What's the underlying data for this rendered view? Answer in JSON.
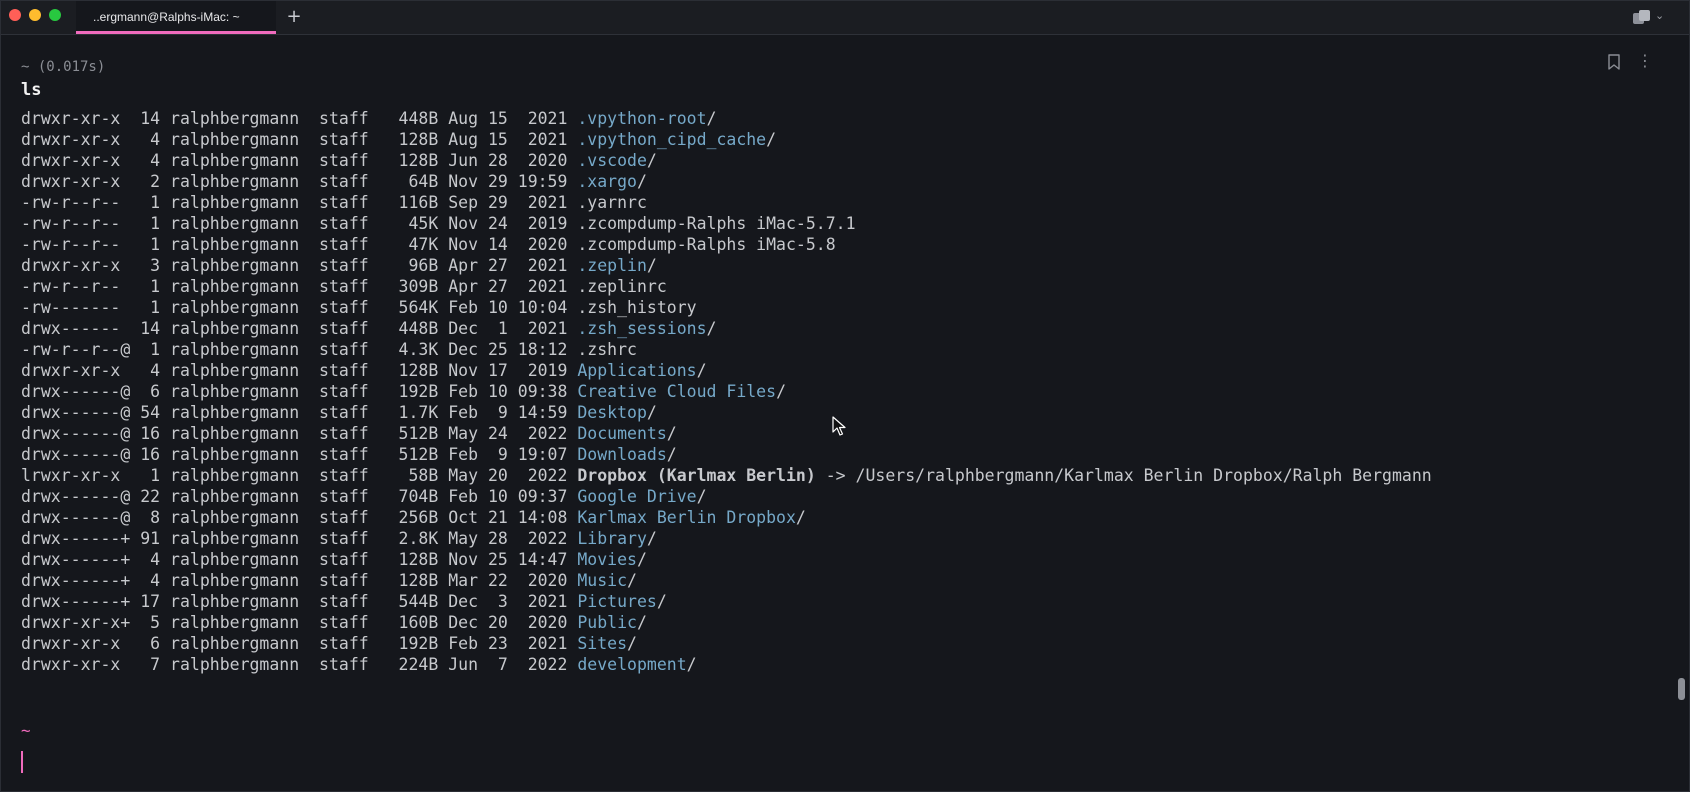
{
  "window": {
    "tab_title": "..ergmann@Ralphs-iMac: ~",
    "new_tab_icon": "plus-icon",
    "panes_icon": "panes-icon"
  },
  "block": {
    "meta": "~ (0.017s)",
    "command": "ls",
    "bookmark_icon": "bookmark-icon",
    "more_icon": "more-vertical-icon"
  },
  "listing": [
    {
      "perms": "drwxr-xr-x ",
      "links": "14",
      "owner": "ralphbergmann",
      "group": "staff",
      "size": "448B",
      "date": "Aug 15  2021",
      "name": ".vpython-root",
      "suffix": "/",
      "kind": "dir"
    },
    {
      "perms": "drwxr-xr-x ",
      "links": " 4",
      "owner": "ralphbergmann",
      "group": "staff",
      "size": "128B",
      "date": "Aug 15  2021",
      "name": ".vpython_cipd_cache",
      "suffix": "/",
      "kind": "dir"
    },
    {
      "perms": "drwxr-xr-x ",
      "links": " 4",
      "owner": "ralphbergmann",
      "group": "staff",
      "size": "128B",
      "date": "Jun 28  2020",
      "name": ".vscode",
      "suffix": "/",
      "kind": "dir"
    },
    {
      "perms": "drwxr-xr-x ",
      "links": " 2",
      "owner": "ralphbergmann",
      "group": "staff",
      "size": " 64B",
      "date": "Nov 29 19:59",
      "name": ".xargo",
      "suffix": "/",
      "kind": "dir"
    },
    {
      "perms": "-rw-r--r-- ",
      "links": " 1",
      "owner": "ralphbergmann",
      "group": "staff",
      "size": "116B",
      "date": "Sep 29  2021",
      "name": ".yarnrc",
      "suffix": "",
      "kind": "file"
    },
    {
      "perms": "-rw-r--r-- ",
      "links": " 1",
      "owner": "ralphbergmann",
      "group": "staff",
      "size": " 45K",
      "date": "Nov 24  2019",
      "name": ".zcompdump-Ralphs iMac-5.7.1",
      "suffix": "",
      "kind": "file"
    },
    {
      "perms": "-rw-r--r-- ",
      "links": " 1",
      "owner": "ralphbergmann",
      "group": "staff",
      "size": " 47K",
      "date": "Nov 14  2020",
      "name": ".zcompdump-Ralphs iMac-5.8",
      "suffix": "",
      "kind": "file"
    },
    {
      "perms": "drwxr-xr-x ",
      "links": " 3",
      "owner": "ralphbergmann",
      "group": "staff",
      "size": " 96B",
      "date": "Apr 27  2021",
      "name": ".zeplin",
      "suffix": "/",
      "kind": "dir"
    },
    {
      "perms": "-rw-r--r-- ",
      "links": " 1",
      "owner": "ralphbergmann",
      "group": "staff",
      "size": "309B",
      "date": "Apr 27  2021",
      "name": ".zeplinrc",
      "suffix": "",
      "kind": "file"
    },
    {
      "perms": "-rw------- ",
      "links": " 1",
      "owner": "ralphbergmann",
      "group": "staff",
      "size": "564K",
      "date": "Feb 10 10:04",
      "name": ".zsh_history",
      "suffix": "",
      "kind": "file"
    },
    {
      "perms": "drwx------ ",
      "links": "14",
      "owner": "ralphbergmann",
      "group": "staff",
      "size": "448B",
      "date": "Dec  1  2021",
      "name": ".zsh_sessions",
      "suffix": "/",
      "kind": "dir"
    },
    {
      "perms": "-rw-r--r--@",
      "links": " 1",
      "owner": "ralphbergmann",
      "group": "staff",
      "size": "4.3K",
      "date": "Dec 25 18:12",
      "name": ".zshrc",
      "suffix": "",
      "kind": "file"
    },
    {
      "perms": "drwxr-xr-x ",
      "links": " 4",
      "owner": "ralphbergmann",
      "group": "staff",
      "size": "128B",
      "date": "Nov 17  2019",
      "name": "Applications",
      "suffix": "/",
      "kind": "dir"
    },
    {
      "perms": "drwx------@",
      "links": " 6",
      "owner": "ralphbergmann",
      "group": "staff",
      "size": "192B",
      "date": "Feb 10 09:38",
      "name": "Creative Cloud Files",
      "suffix": "/",
      "kind": "dir"
    },
    {
      "perms": "drwx------@",
      "links": "54",
      "owner": "ralphbergmann",
      "group": "staff",
      "size": "1.7K",
      "date": "Feb  9 14:59",
      "name": "Desktop",
      "suffix": "/",
      "kind": "dir"
    },
    {
      "perms": "drwx------@",
      "links": "16",
      "owner": "ralphbergmann",
      "group": "staff",
      "size": "512B",
      "date": "May 24  2022",
      "name": "Documents",
      "suffix": "/",
      "kind": "dir"
    },
    {
      "perms": "drwx------@",
      "links": "16",
      "owner": "ralphbergmann",
      "group": "staff",
      "size": "512B",
      "date": "Feb  9 19:07",
      "name": "Downloads",
      "suffix": "/",
      "kind": "dir"
    },
    {
      "perms": "lrwxr-xr-x ",
      "links": " 1",
      "owner": "ralphbergmann",
      "group": "staff",
      "size": " 58B",
      "date": "May 20  2022",
      "name": "Dropbox (Karlmax Berlin)",
      "suffix": "",
      "kind": "link",
      "arrow": " -> ",
      "target": "/Users/ralphbergmann/Karlmax Berlin Dropbox/Ralph Bergmann"
    },
    {
      "perms": "drwx------@",
      "links": "22",
      "owner": "ralphbergmann",
      "group": "staff",
      "size": "704B",
      "date": "Feb 10 09:37",
      "name": "Google Drive",
      "suffix": "/",
      "kind": "dir"
    },
    {
      "perms": "drwx------@",
      "links": " 8",
      "owner": "ralphbergmann",
      "group": "staff",
      "size": "256B",
      "date": "Oct 21 14:08",
      "name": "Karlmax Berlin Dropbox",
      "suffix": "/",
      "kind": "dir"
    },
    {
      "perms": "drwx------+",
      "links": "91",
      "owner": "ralphbergmann",
      "group": "staff",
      "size": "2.8K",
      "date": "May 28  2022",
      "name": "Library",
      "suffix": "/",
      "kind": "dir"
    },
    {
      "perms": "drwx------+",
      "links": " 4",
      "owner": "ralphbergmann",
      "group": "staff",
      "size": "128B",
      "date": "Nov 25 14:47",
      "name": "Movies",
      "suffix": "/",
      "kind": "dir"
    },
    {
      "perms": "drwx------+",
      "links": " 4",
      "owner": "ralphbergmann",
      "group": "staff",
      "size": "128B",
      "date": "Mar 22  2020",
      "name": "Music",
      "suffix": "/",
      "kind": "dir"
    },
    {
      "perms": "drwx------+",
      "links": "17",
      "owner": "ralphbergmann",
      "group": "staff",
      "size": "544B",
      "date": "Dec  3  2021",
      "name": "Pictures",
      "suffix": "/",
      "kind": "dir"
    },
    {
      "perms": "drwxr-xr-x+",
      "links": " 5",
      "owner": "ralphbergmann",
      "group": "staff",
      "size": "160B",
      "date": "Dec 20  2020",
      "name": "Public",
      "suffix": "/",
      "kind": "dir"
    },
    {
      "perms": "drwxr-xr-x ",
      "links": " 6",
      "owner": "ralphbergmann",
      "group": "staff",
      "size": "192B",
      "date": "Feb 23  2021",
      "name": "Sites",
      "suffix": "/",
      "kind": "dir"
    },
    {
      "perms": "drwxr-xr-x ",
      "links": " 7",
      "owner": "ralphbergmann",
      "group": "staff",
      "size": "224B",
      "date": "Jun  7  2022",
      "name": "development",
      "suffix": "/",
      "kind": "dir"
    }
  ],
  "prompt": {
    "dir": "~"
  },
  "colors": {
    "accent": "#f06bbd",
    "directory": "#76a9c9",
    "text": "#c7c9cd",
    "background": "#15171c"
  }
}
